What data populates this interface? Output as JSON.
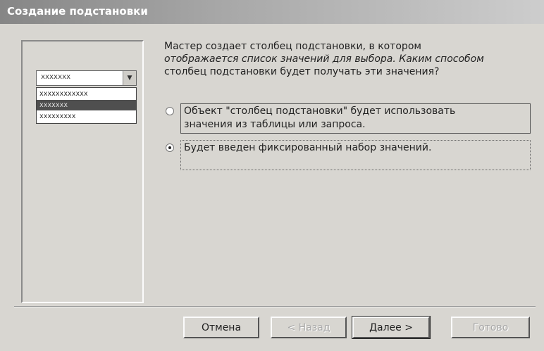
{
  "window": {
    "title": "Создание подстановки"
  },
  "preview": {
    "combo_value": "xxxxxxx",
    "dropdown_items": [
      "xxxxxxxxxxxx",
      "xxxxxxx",
      "xxxxxxxxx"
    ],
    "selected_index": 1
  },
  "description": [
    "Мастер создает столбец подстановки, в котором",
    "отображается список значений для выбора.  Каким способом",
    "столбец подстановки будет получать эти значения?"
  ],
  "options": [
    {
      "label_line1": "Объект \"столбец подстановки\" будет использовать",
      "label_line2": "значения из таблицы или запроса.",
      "checked": false
    },
    {
      "label_line1": "Будет введен фиксированный набор значений.",
      "label_line2": "",
      "checked": true
    }
  ],
  "buttons": {
    "cancel": "Отмена",
    "back": "< Назад",
    "next": "Далее >",
    "finish": "Готово"
  }
}
